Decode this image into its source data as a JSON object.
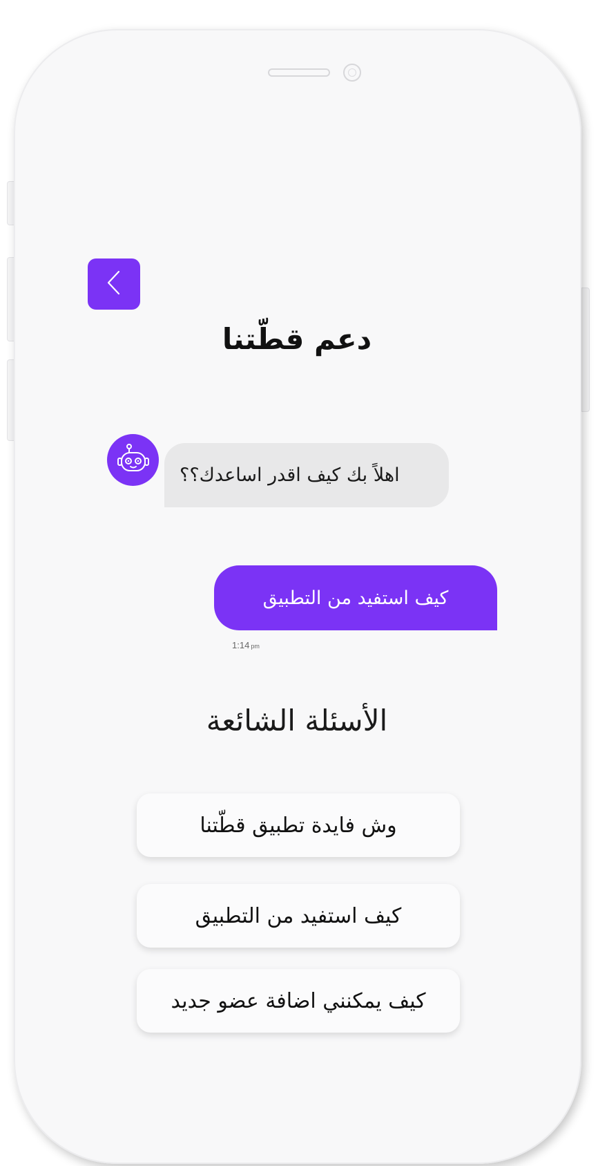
{
  "header": {
    "title": "دعم قطّتنا",
    "back_icon": "chevron-left-icon"
  },
  "chat": {
    "bot_avatar_icon": "robot-icon",
    "bot_message": "اهلاً بك كيف اقدر اساعدك؟؟",
    "user_message": "كيف استفيد من التطبيق",
    "timestamp": "1:14",
    "timestamp_suffix": "pm"
  },
  "faq": {
    "heading": "الأسئلة الشائعة",
    "items": [
      {
        "label": "وش فايدة تطبيق قطّتنا"
      },
      {
        "label": "كيف استفيد من التطبيق"
      },
      {
        "label": "كيف يمكنني اضافة عضو جديد"
      }
    ]
  },
  "colors": {
    "accent": "#7b33f5",
    "bot_bubble": "#e8e8e9",
    "screen_bg": "#f8f8f9"
  }
}
